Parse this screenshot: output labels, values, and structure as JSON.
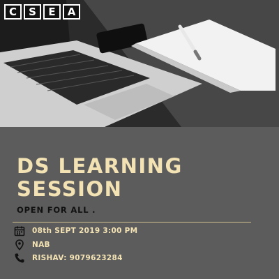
{
  "logo": {
    "letters": [
      "C",
      "S",
      "E",
      "A"
    ]
  },
  "event": {
    "title_line1": "DS  LEARNING",
    "title_line2": "SESSION",
    "subtitle": "OPEN FOR ALL ."
  },
  "details": {
    "datetime": "08th SEPT 2019  3:00 PM",
    "venue": "NAB",
    "contact": "RISHAV: 9079623284"
  },
  "icons": {
    "date": "calendar-icon",
    "venue": "location-pin-icon",
    "contact": "phone-icon"
  },
  "colors": {
    "accent": "#f3e2b3",
    "panel": "#5c5c5c",
    "subtitle": "#111111"
  }
}
